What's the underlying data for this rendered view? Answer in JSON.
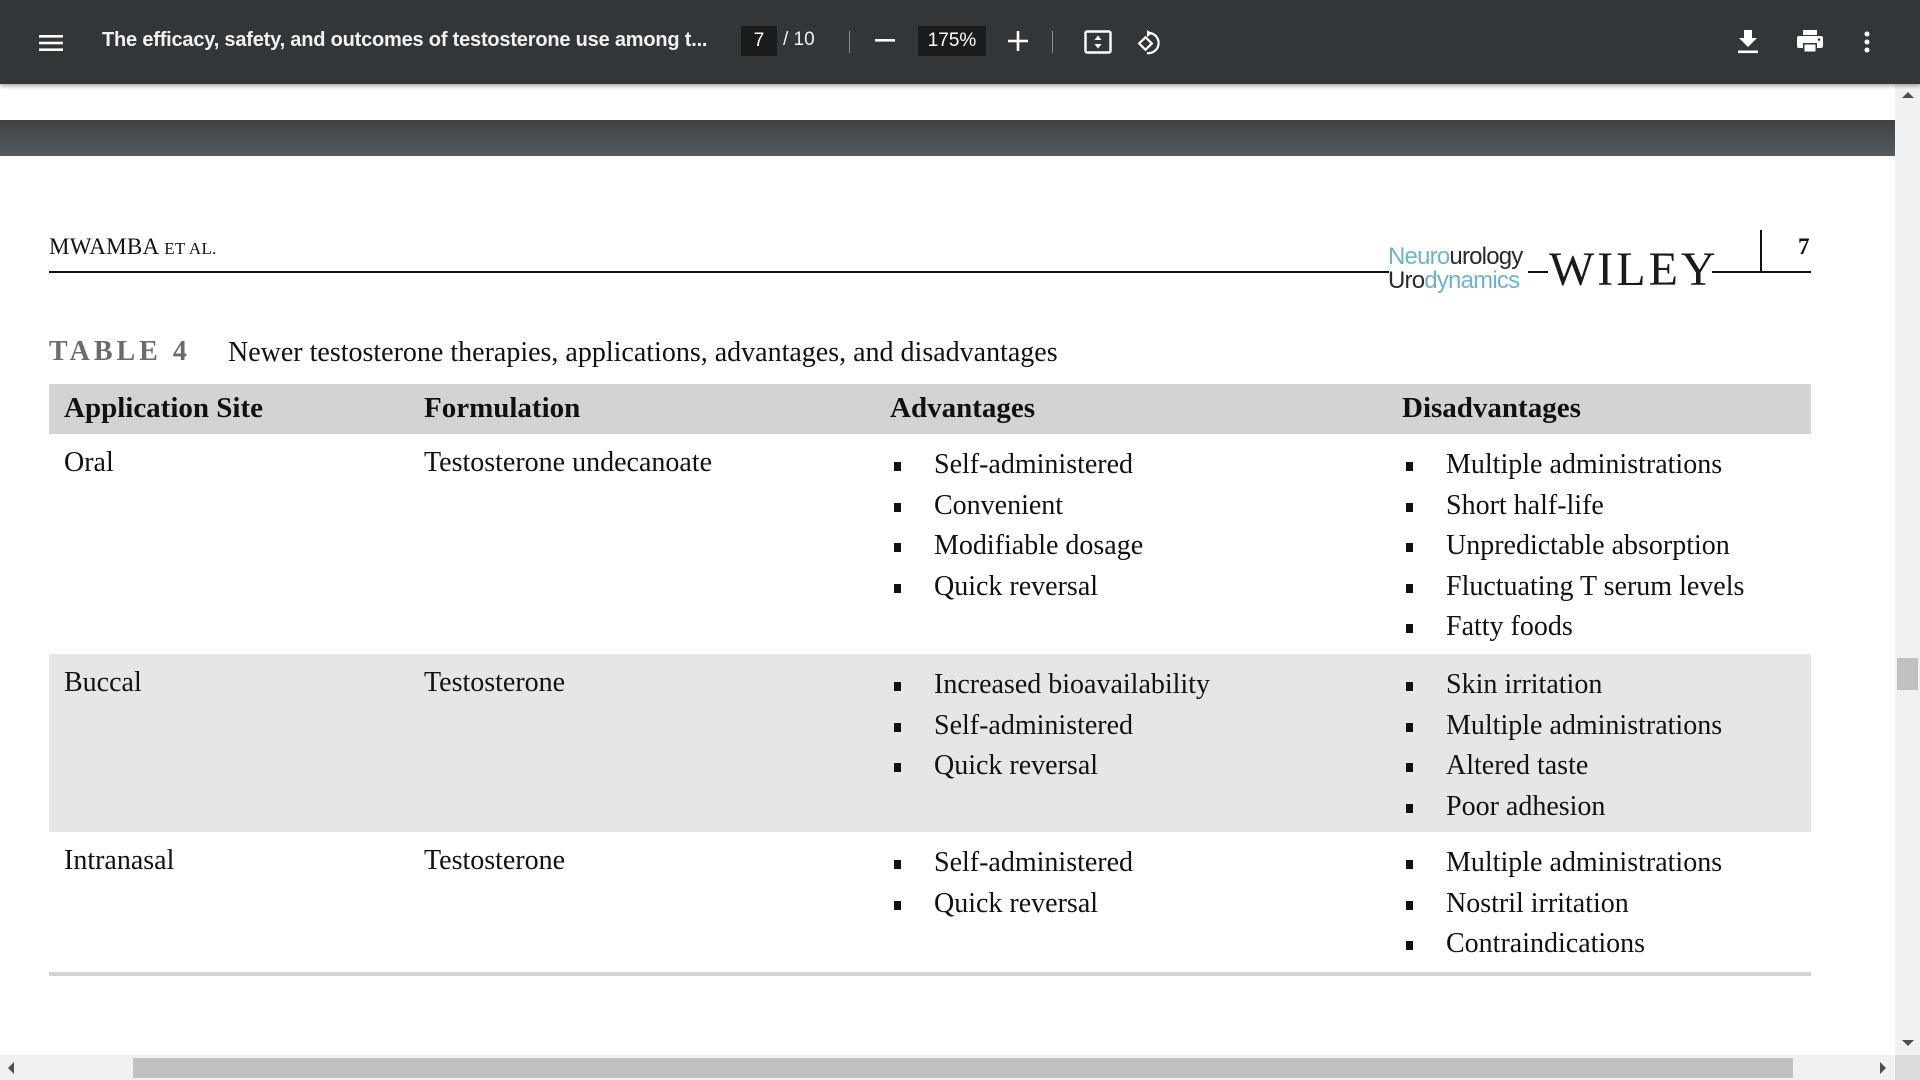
{
  "toolbar": {
    "title": "The efficacy, safety, and outcomes of testosterone use among t...",
    "current_page": "7",
    "total_pages": "/ 10",
    "zoom": "175%",
    "icons": {
      "menu": "hamburger-menu-icon",
      "zoom_out": "minus-icon",
      "zoom_in": "plus-icon",
      "fit": "fit-to-page-icon",
      "rotate": "rotate-counterclockwise-icon",
      "download": "download-icon",
      "print": "print-icon",
      "more": "more-vertical-icon"
    }
  },
  "page": {
    "running_head_author": "MWAMBA",
    "running_head_etal": "ET AL.",
    "journal_logo_line1_a": "eurourology",
    "journal_logo_line1_prefix": "N",
    "journal_logo_line2_prefix": "U",
    "journal_logo_line2_a": "ro",
    "journal_logo_line2_b": "dynamics",
    "publisher": "WILEY",
    "page_number": "7",
    "table_label": "TABLE 4",
    "table_caption": "Newer testosterone therapies, applications, advantages, and disadvantages",
    "table": {
      "headers": [
        "Application Site",
        "Formulation",
        "Advantages",
        "Disadvantages"
      ],
      "rows": [
        {
          "site": "Oral",
          "formulation": "Testosterone undecanoate",
          "advantages": [
            "Self-administered",
            "Convenient",
            "Modifiable dosage",
            "Quick reversal"
          ],
          "disadvantages": [
            "Multiple administrations",
            "Short half-life",
            "Unpredictable absorption",
            "Fluctuating T serum levels",
            "Fatty foods"
          ]
        },
        {
          "site": "Buccal",
          "formulation": "Testosterone",
          "advantages": [
            "Increased bioavailability",
            "Self-administered",
            "Quick reversal"
          ],
          "disadvantages": [
            "Skin irritation",
            "Multiple administrations",
            "Altered taste",
            "Poor adhesion"
          ]
        },
        {
          "site": "Intranasal",
          "formulation": "Testosterone",
          "advantages": [
            "Self-administered",
            "Quick reversal"
          ],
          "disadvantages": [
            "Multiple administrations",
            "Nostril irritation",
            "Contraindications"
          ]
        }
      ]
    }
  },
  "colors": {
    "toolbar_bg": "#323639",
    "table_header_bg": "#d1d3d4",
    "shaded_row_bg": "#e6e6e8",
    "logo_blue": "#6fb2cf"
  }
}
